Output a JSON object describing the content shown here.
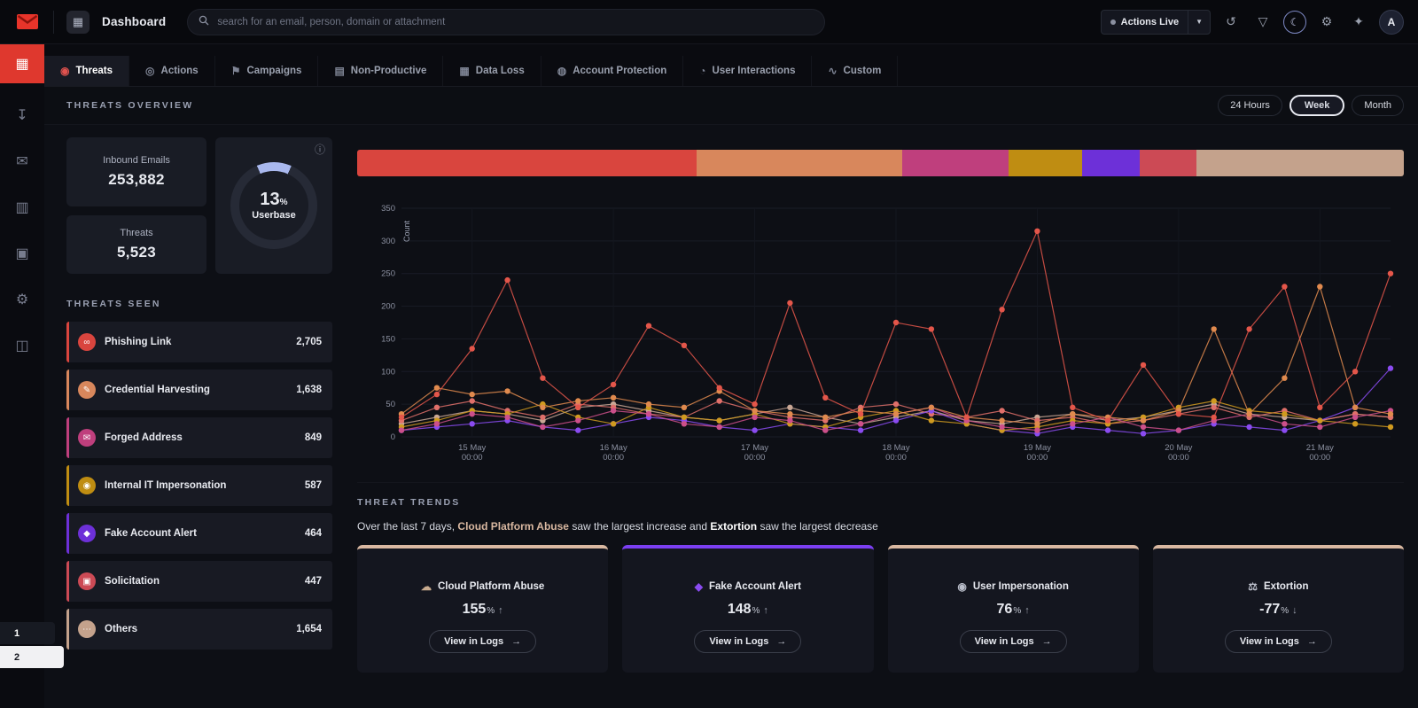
{
  "icons": {
    "dashboard": "▦",
    "download": "↧",
    "mail-out": "✉",
    "building": "▥",
    "image-mail": "▣",
    "services": "⚙",
    "briefcase": "◫",
    "history": "↺",
    "filter": "▽",
    "moon": "☾",
    "gear": "⚙",
    "sparkle": "✦",
    "caret-down": "▼",
    "info": "ⓘ",
    "arrow-right": "→",
    "tab-threats": "◉",
    "tab-actions": "◎",
    "tab-campaigns": "⚑",
    "tab-nonproductive": "▤",
    "tab-dataloss": "▦",
    "tab-account": "◍",
    "tab-user": "◔",
    "tab-custom": "∿",
    "link": "∞",
    "paperclip": "✎",
    "badge": "✉",
    "people": "◉",
    "tag": "◆",
    "chat": "▣",
    "dots": "⋯",
    "cloud": "☁",
    "scales": "⚖"
  },
  "topbar": {
    "title": "Dashboard",
    "search_placeholder": "search for an email, person, domain or attachment",
    "actions_live_label": "Actions Live",
    "avatar_initial": "A"
  },
  "tabs": [
    {
      "label": "Threats",
      "active": true
    },
    {
      "label": "Actions",
      "active": false
    },
    {
      "label": "Campaigns",
      "active": false
    },
    {
      "label": "Non-Productive",
      "active": false
    },
    {
      "label": "Data Loss",
      "active": false
    },
    {
      "label": "Account Protection",
      "active": false
    },
    {
      "label": "User Interactions",
      "active": false
    },
    {
      "label": "Custom",
      "active": false
    }
  ],
  "overview": {
    "section_title": "THREATS OVERVIEW",
    "range_24h": "24 Hours",
    "range_week": "Week",
    "range_month": "Month",
    "selected_range": "Week",
    "inbound_label": "Inbound Emails",
    "inbound_value": "253,882",
    "threats_label": "Threats",
    "threats_value": "5,523",
    "donut_value": "13",
    "donut_unit": "%",
    "donut_label": "Userbase",
    "donut_fill_pct": 13,
    "donut_color": "#a9b8ee"
  },
  "threats_seen": {
    "section_title": "THREATS SEEN",
    "items": [
      {
        "label": "Phishing Link",
        "count": "2,705",
        "value": 2705,
        "color": "#d9453e",
        "icon": "link"
      },
      {
        "label": "Credential Harvesting",
        "count": "1,638",
        "value": 1638,
        "color": "#d8875c",
        "icon": "paperclip"
      },
      {
        "label": "Forged Address",
        "count": "849",
        "value": 849,
        "color": "#bf3f7d",
        "icon": "badge"
      },
      {
        "label": "Internal IT Impersonation",
        "count": "587",
        "value": 587,
        "color": "#bf8d12",
        "icon": "people"
      },
      {
        "label": "Fake Account Alert",
        "count": "464",
        "value": 464,
        "color": "#6d30d8",
        "icon": "tag"
      },
      {
        "label": "Solicitation",
        "count": "447",
        "value": 447,
        "color": "#cc4a55",
        "icon": "chat"
      },
      {
        "label": "Others",
        "count": "1,654",
        "value": 1654,
        "color": "#c4a28c",
        "icon": "dots"
      }
    ]
  },
  "chart_data": {
    "type": "line",
    "title": "Threats seen over time",
    "xlabel": "",
    "ylabel": "Count",
    "ylim": [
      0,
      350
    ],
    "yticks": [
      0,
      50,
      100,
      150,
      200,
      250,
      300,
      350
    ],
    "grid": true,
    "legend": false,
    "x_tick_indices": [
      2,
      6,
      10,
      14,
      18,
      22,
      26
    ],
    "x_tick_labels": [
      "15 May\n00:00",
      "16 May\n00:00",
      "17 May\n00:00",
      "18 May\n00:00",
      "19 May\n00:00",
      "20 May\n00:00",
      "21 May\n00:00"
    ],
    "series": [
      {
        "name": "Phishing Link",
        "color": "#e4564a",
        "values": [
          30,
          65,
          135,
          240,
          90,
          45,
          80,
          170,
          140,
          75,
          50,
          205,
          60,
          35,
          175,
          165,
          30,
          195,
          315,
          45,
          25,
          110,
          35,
          30,
          165,
          230,
          45,
          100,
          250
        ]
      },
      {
        "name": "Credential Harvesting",
        "color": "#e08a4e",
        "values": [
          35,
          75,
          65,
          70,
          45,
          55,
          60,
          50,
          45,
          70,
          40,
          35,
          30,
          40,
          35,
          45,
          30,
          25,
          20,
          35,
          30,
          25,
          40,
          165,
          35,
          90,
          230,
          45,
          35
        ]
      },
      {
        "name": "Forged Address",
        "color": "#cc4f8a",
        "values": [
          10,
          20,
          35,
          30,
          15,
          25,
          40,
          35,
          20,
          15,
          30,
          25,
          10,
          20,
          35,
          45,
          25,
          15,
          10,
          20,
          30,
          15,
          10,
          25,
          35,
          20,
          15,
          30,
          40
        ]
      },
      {
        "name": "Internal IT Impersonation",
        "color": "#d09a1f",
        "values": [
          15,
          25,
          40,
          35,
          50,
          30,
          20,
          45,
          30,
          25,
          35,
          20,
          15,
          30,
          40,
          25,
          20,
          10,
          15,
          25,
          20,
          30,
          45,
          55,
          40,
          35,
          25,
          20,
          15
        ]
      },
      {
        "name": "Fake Account Alert",
        "color": "#8a4bf0",
        "values": [
          10,
          15,
          20,
          25,
          15,
          10,
          20,
          30,
          25,
          15,
          10,
          20,
          15,
          10,
          25,
          40,
          20,
          10,
          5,
          15,
          10,
          5,
          10,
          20,
          15,
          10,
          25,
          45,
          105
        ]
      },
      {
        "name": "Solicitation",
        "color": "#e0706a",
        "values": [
          25,
          45,
          55,
          40,
          30,
          50,
          45,
          35,
          30,
          55,
          40,
          30,
          25,
          45,
          50,
          35,
          30,
          40,
          25,
          30,
          20,
          25,
          35,
          45,
          30,
          40,
          25,
          35,
          30
        ]
      },
      {
        "name": "Others",
        "color": "#c9a795",
        "values": [
          20,
          30,
          40,
          35,
          25,
          45,
          50,
          40,
          30,
          25,
          35,
          45,
          30,
          20,
          30,
          40,
          25,
          20,
          30,
          35,
          25,
          30,
          40,
          50,
          35,
          30,
          25,
          35,
          30
        ]
      }
    ]
  },
  "trends": {
    "section_title": "THREAT TRENDS",
    "summary_prefix": "Over the last 7 days,",
    "summary_increase": "Cloud Platform Abuse",
    "summary_mid": "saw the largest increase and",
    "summary_decrease": "Extortion",
    "summary_suffix": "saw the largest decrease",
    "cards": [
      {
        "label": "Cloud Platform Abuse",
        "value": "155",
        "unit": "%",
        "arrow": "↑",
        "accent": "#d9b8a1",
        "icon": "cloud",
        "icon_color": "#c9ab8f",
        "button": "View in Logs"
      },
      {
        "label": "Fake Account Alert",
        "value": "148",
        "unit": "%",
        "arrow": "↑",
        "accent": "#7b3ff2",
        "icon": "tag",
        "icon_color": "#8a4bf0",
        "button": "View in Logs"
      },
      {
        "label": "User Impersonation",
        "value": "76",
        "unit": "%",
        "arrow": "↑",
        "accent": "#d9b8a1",
        "icon": "people",
        "icon_color": "#b9bdc9",
        "button": "View in Logs"
      },
      {
        "label": "Extortion",
        "value": "-77",
        "unit": "%",
        "arrow": "↓",
        "accent": "#d9b8a1",
        "icon": "scales",
        "icon_color": "#b9bdc9",
        "button": "View in Logs"
      }
    ]
  },
  "page_markers": [
    "1",
    "2"
  ]
}
